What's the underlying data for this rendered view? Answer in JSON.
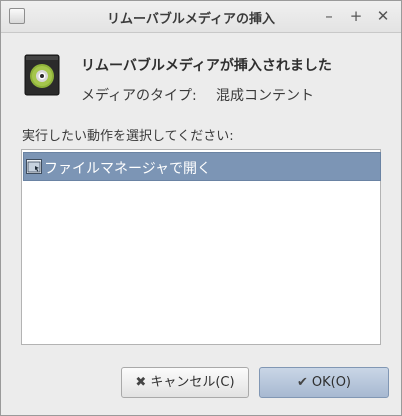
{
  "window": {
    "title": "リムーバブルメディアの挿入",
    "minimize_glyph": "–",
    "maximize_glyph": "+",
    "close_glyph": "✕"
  },
  "header": {
    "icon": "optical-disc-icon",
    "title": "リムーバブルメディアが挿入されました",
    "media_type_label": "メディアのタイプ:",
    "media_type_value": "混成コンテント"
  },
  "prompt": "実行したい動作を選択してください:",
  "actions": [
    {
      "icon": "folder-icon",
      "label": "ファイルマネージャで開く",
      "selected": true
    }
  ],
  "buttons": {
    "cancel": {
      "icon": "cross-icon",
      "glyph": "✖",
      "label": "キャンセル(C)"
    },
    "ok": {
      "icon": "checkmark-icon",
      "glyph": "✔",
      "label": "OK(O)"
    }
  },
  "colors": {
    "selection": "#7c95b5",
    "ok_button": "#b8c7dc"
  }
}
